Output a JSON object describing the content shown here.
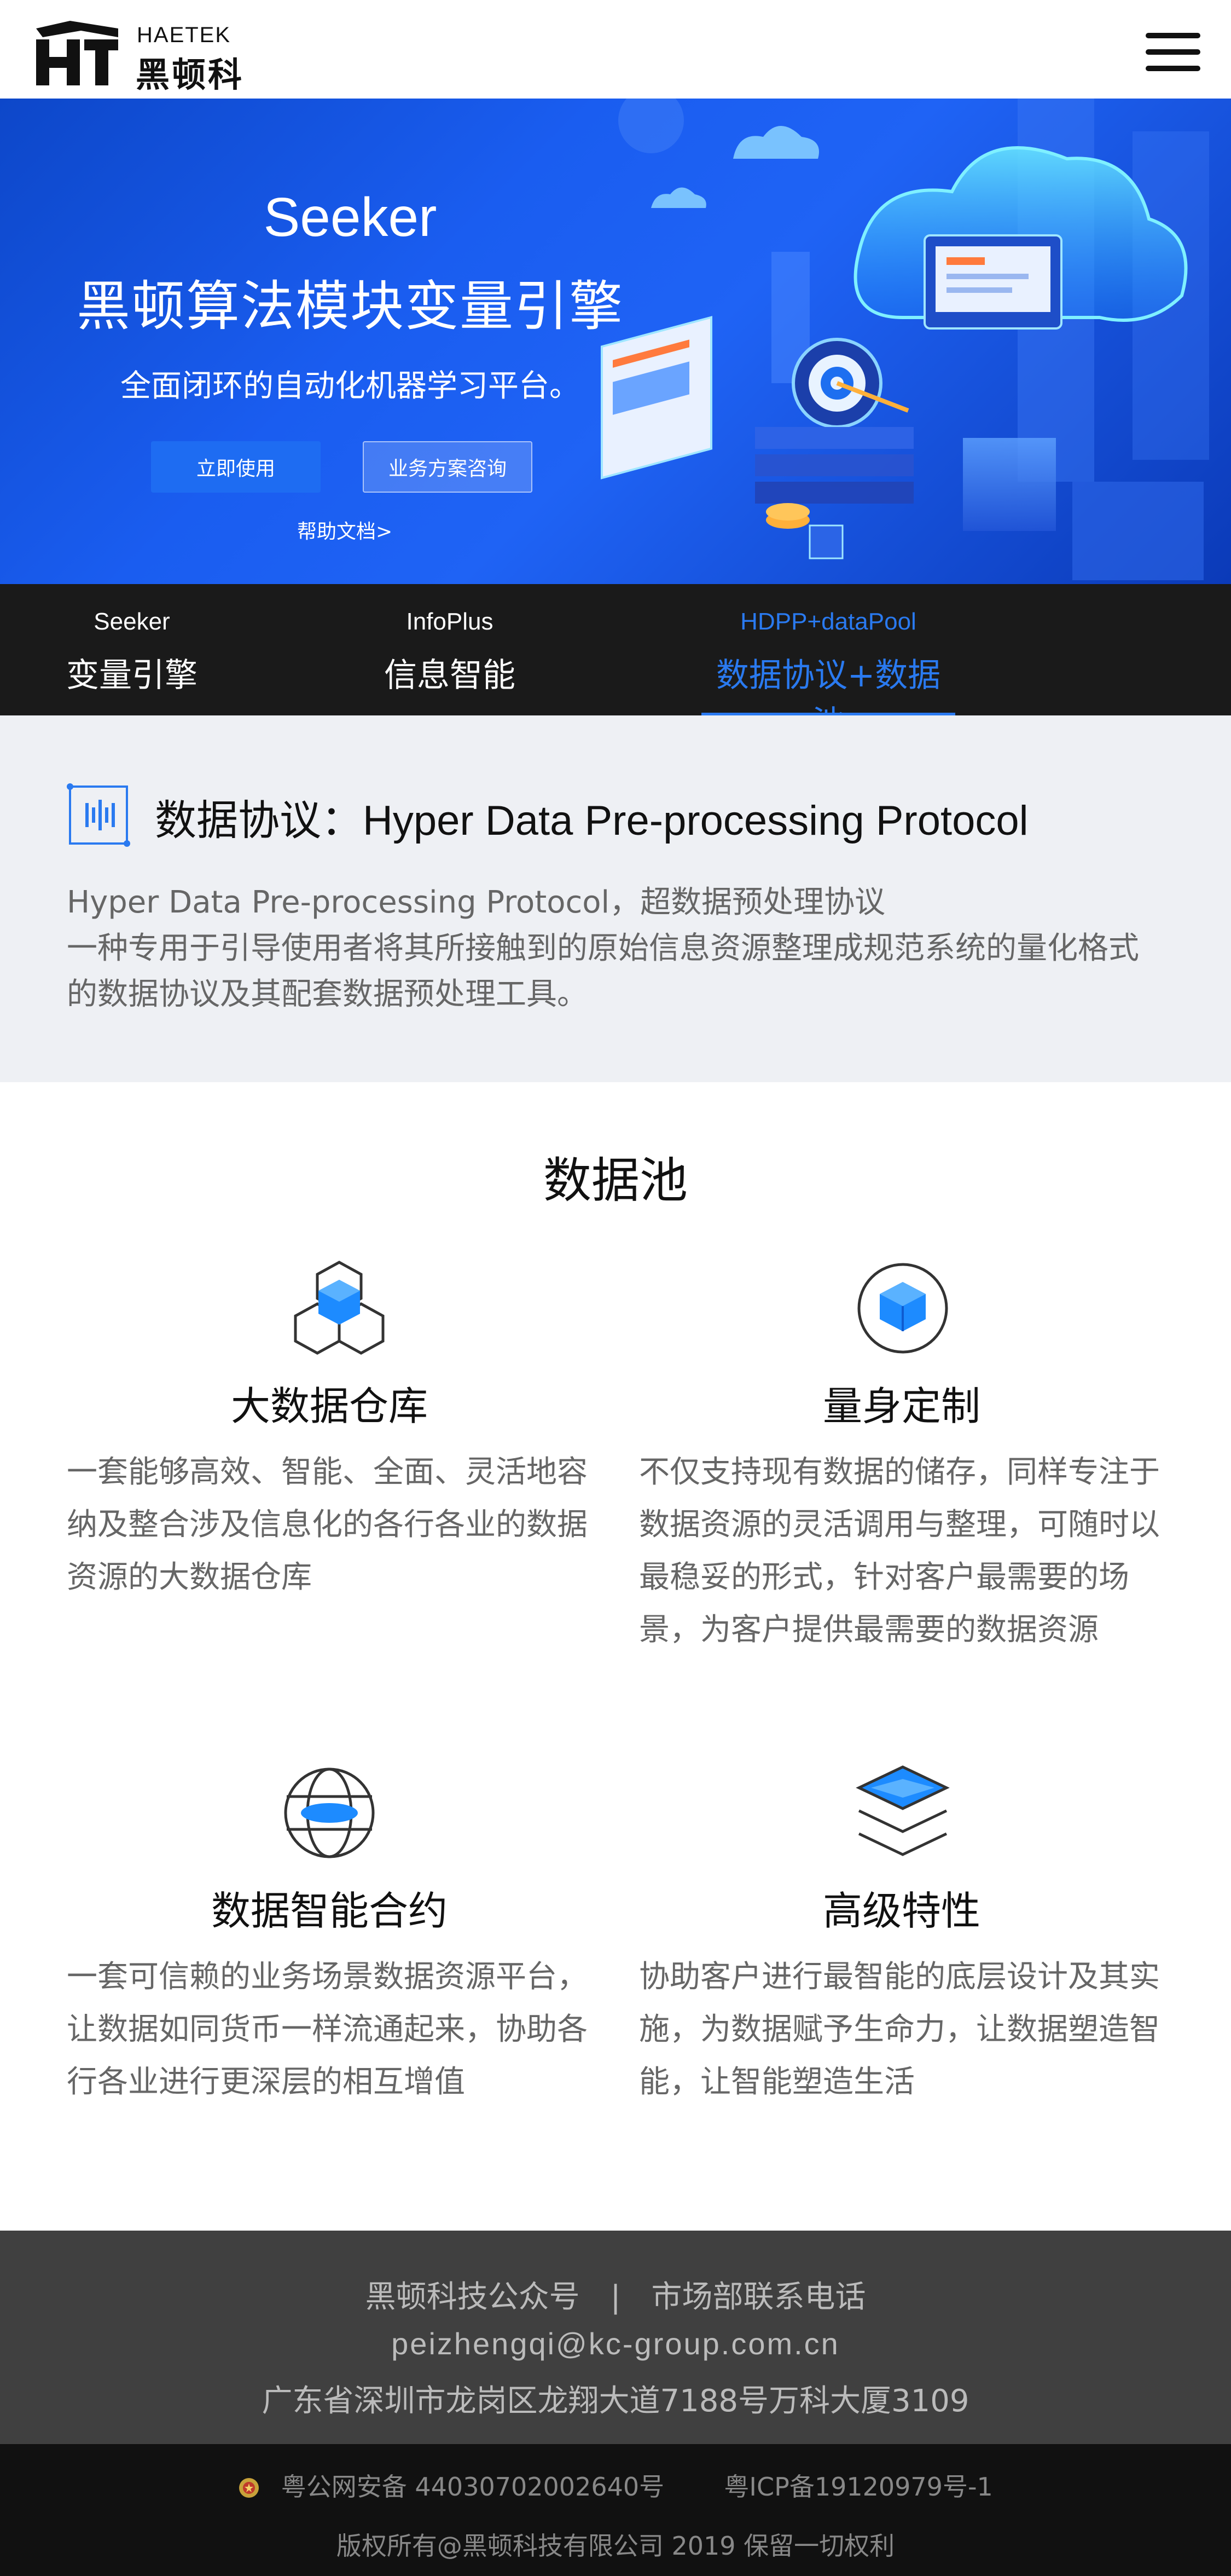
{
  "header": {
    "brand_en": "HAETEK",
    "brand_cn": "黑顿科技"
  },
  "hero": {
    "title": "Seeker",
    "subtitle": "黑顿算法模块变量引擎",
    "description": "全面闭环的自动化机器学习平台。",
    "primary_button": "立即使用",
    "secondary_button": "业务方案咨询",
    "help_link": "帮助文档>"
  },
  "tabs": [
    {
      "en": "Seeker",
      "cn": "变量引擎",
      "active": false
    },
    {
      "en": "InfoPlus",
      "cn": "信息智能",
      "active": false
    },
    {
      "en": "HDPP+dataPool",
      "cn": "数据协议+数据池",
      "active": true
    }
  ],
  "protocol": {
    "title": "数据协议：Hyper Data Pre-processing Protocol",
    "line1": "Hyper Data Pre-processing Protocol，超数据预处理协议",
    "line2": "一种专用于引导使用者将其所接触到的原始信息资源整理成规范系统的量化格式的数据协议及其配套数据预处理工具。"
  },
  "datapool": {
    "title": "数据池",
    "features": [
      {
        "name": "大数据仓库",
        "icon": "cubes-icon",
        "desc": "一套能够高效、智能、全面、灵活地容纳及整合涉及信息化的各行各业的数据资源的大数据仓库"
      },
      {
        "name": "量身定制",
        "icon": "custom-cube-icon",
        "desc": "不仅支持现有数据的储存，同样专注于数据资源的灵活调用与整理，可随时以最稳妥的形式，针对客户最需要的场景，为客户提供最需要的数据资源"
      },
      {
        "name": "数据智能合约",
        "icon": "globe-icon",
        "desc": "一套可信赖的业务场景数据资源平台，让数据如同货币一样流通起来，协助各行各业进行更深层的相互增值"
      },
      {
        "name": "高级特性",
        "icon": "layers-icon",
        "desc": "协助客户进行最智能的底层设计及其实施，为数据赋予生命力，让数据塑造智能，让智能塑造生活"
      }
    ]
  },
  "footer": {
    "wechat": "黑顿科技公众号",
    "separator": "|",
    "phone": "市场部联系电话",
    "email": "peizhengqi@kc-group.com.cn",
    "address": "广东省深圳市龙岗区龙翔大道7188号万科大厦3109"
  },
  "copyright": {
    "police_record": "粤公网安备 44030702002640号",
    "icp_record": "粤ICP备19120979号-1",
    "text": "版权所有@黑顿科技有限公司 2019 保留一切权利"
  },
  "colors": {
    "accent": "#2a7af0",
    "hero_blue": "#1a5df0",
    "dark_bar": "#1a1a1a",
    "footer_bg": "#404040",
    "copyright_bg": "#111111"
  }
}
